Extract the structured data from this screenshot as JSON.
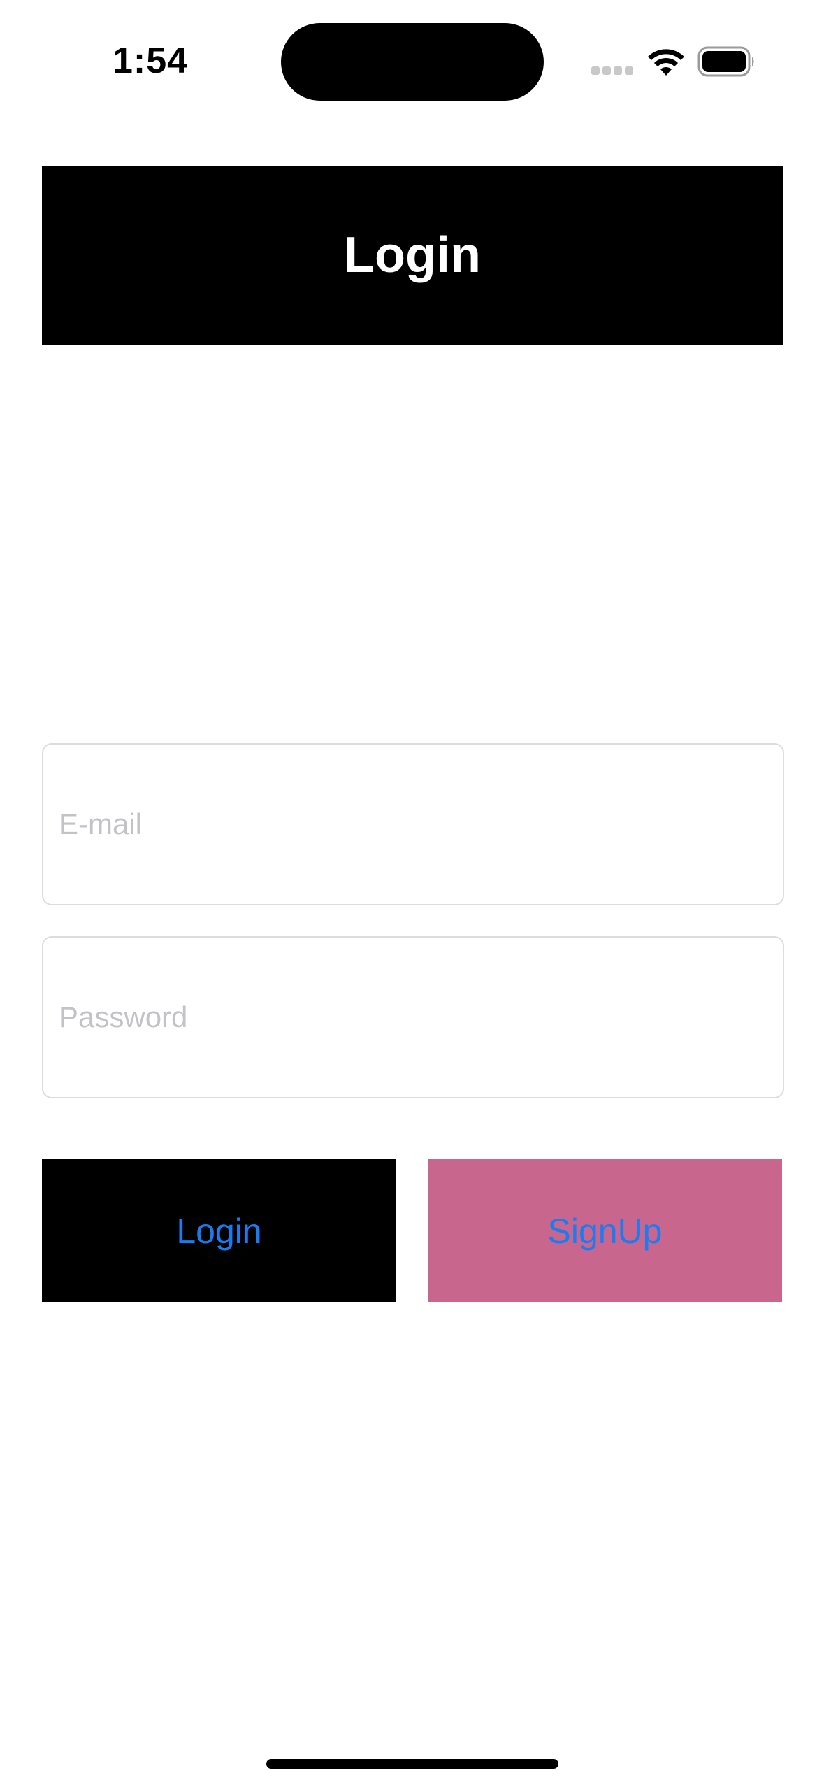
{
  "status_bar": {
    "time": "1:54",
    "icons": [
      "cellular-signal-icon",
      "wifi-icon",
      "battery-icon"
    ]
  },
  "header": {
    "title": "Login"
  },
  "form": {
    "email_placeholder": "E-mail",
    "email_value": "",
    "password_placeholder": "Password",
    "password_value": ""
  },
  "buttons": {
    "login_label": "Login",
    "signup_label": "SignUp"
  },
  "colors": {
    "header_background": "#000000",
    "header_text": "#ffffff",
    "button_text": "#1a7cf2",
    "login_button_background": "#000000",
    "signup_button_background": "#c8668e",
    "placeholder_text": "#c3c3c7",
    "field_border": "#dcdcdc"
  }
}
